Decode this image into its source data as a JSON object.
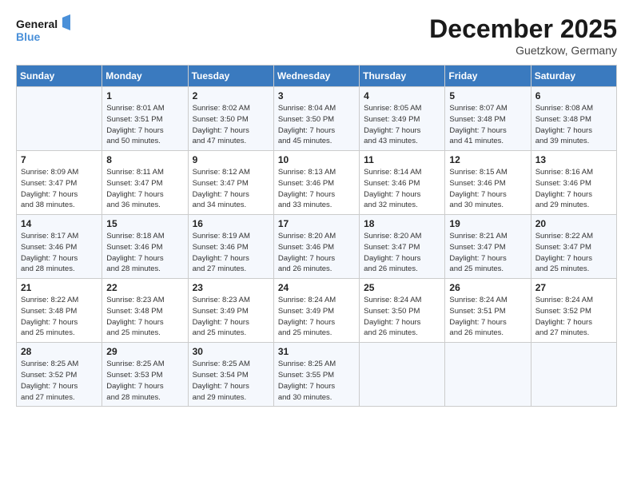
{
  "logo": {
    "line1": "General",
    "line2": "Blue"
  },
  "title": "December 2025",
  "location": "Guetzkow, Germany",
  "days_of_week": [
    "Sunday",
    "Monday",
    "Tuesday",
    "Wednesday",
    "Thursday",
    "Friday",
    "Saturday"
  ],
  "weeks": [
    [
      {
        "day": "",
        "sunrise": "",
        "sunset": "",
        "daylight": ""
      },
      {
        "day": "1",
        "sunrise": "Sunrise: 8:01 AM",
        "sunset": "Sunset: 3:51 PM",
        "daylight": "Daylight: 7 hours and 50 minutes."
      },
      {
        "day": "2",
        "sunrise": "Sunrise: 8:02 AM",
        "sunset": "Sunset: 3:50 PM",
        "daylight": "Daylight: 7 hours and 47 minutes."
      },
      {
        "day": "3",
        "sunrise": "Sunrise: 8:04 AM",
        "sunset": "Sunset: 3:50 PM",
        "daylight": "Daylight: 7 hours and 45 minutes."
      },
      {
        "day": "4",
        "sunrise": "Sunrise: 8:05 AM",
        "sunset": "Sunset: 3:49 PM",
        "daylight": "Daylight: 7 hours and 43 minutes."
      },
      {
        "day": "5",
        "sunrise": "Sunrise: 8:07 AM",
        "sunset": "Sunset: 3:48 PM",
        "daylight": "Daylight: 7 hours and 41 minutes."
      },
      {
        "day": "6",
        "sunrise": "Sunrise: 8:08 AM",
        "sunset": "Sunset: 3:48 PM",
        "daylight": "Daylight: 7 hours and 39 minutes."
      }
    ],
    [
      {
        "day": "7",
        "sunrise": "Sunrise: 8:09 AM",
        "sunset": "Sunset: 3:47 PM",
        "daylight": "Daylight: 7 hours and 38 minutes."
      },
      {
        "day": "8",
        "sunrise": "Sunrise: 8:11 AM",
        "sunset": "Sunset: 3:47 PM",
        "daylight": "Daylight: 7 hours and 36 minutes."
      },
      {
        "day": "9",
        "sunrise": "Sunrise: 8:12 AM",
        "sunset": "Sunset: 3:47 PM",
        "daylight": "Daylight: 7 hours and 34 minutes."
      },
      {
        "day": "10",
        "sunrise": "Sunrise: 8:13 AM",
        "sunset": "Sunset: 3:46 PM",
        "daylight": "Daylight: 7 hours and 33 minutes."
      },
      {
        "day": "11",
        "sunrise": "Sunrise: 8:14 AM",
        "sunset": "Sunset: 3:46 PM",
        "daylight": "Daylight: 7 hours and 32 minutes."
      },
      {
        "day": "12",
        "sunrise": "Sunrise: 8:15 AM",
        "sunset": "Sunset: 3:46 PM",
        "daylight": "Daylight: 7 hours and 30 minutes."
      },
      {
        "day": "13",
        "sunrise": "Sunrise: 8:16 AM",
        "sunset": "Sunset: 3:46 PM",
        "daylight": "Daylight: 7 hours and 29 minutes."
      }
    ],
    [
      {
        "day": "14",
        "sunrise": "Sunrise: 8:17 AM",
        "sunset": "Sunset: 3:46 PM",
        "daylight": "Daylight: 7 hours and 28 minutes."
      },
      {
        "day": "15",
        "sunrise": "Sunrise: 8:18 AM",
        "sunset": "Sunset: 3:46 PM",
        "daylight": "Daylight: 7 hours and 28 minutes."
      },
      {
        "day": "16",
        "sunrise": "Sunrise: 8:19 AM",
        "sunset": "Sunset: 3:46 PM",
        "daylight": "Daylight: 7 hours and 27 minutes."
      },
      {
        "day": "17",
        "sunrise": "Sunrise: 8:20 AM",
        "sunset": "Sunset: 3:46 PM",
        "daylight": "Daylight: 7 hours and 26 minutes."
      },
      {
        "day": "18",
        "sunrise": "Sunrise: 8:20 AM",
        "sunset": "Sunset: 3:47 PM",
        "daylight": "Daylight: 7 hours and 26 minutes."
      },
      {
        "day": "19",
        "sunrise": "Sunrise: 8:21 AM",
        "sunset": "Sunset: 3:47 PM",
        "daylight": "Daylight: 7 hours and 25 minutes."
      },
      {
        "day": "20",
        "sunrise": "Sunrise: 8:22 AM",
        "sunset": "Sunset: 3:47 PM",
        "daylight": "Daylight: 7 hours and 25 minutes."
      }
    ],
    [
      {
        "day": "21",
        "sunrise": "Sunrise: 8:22 AM",
        "sunset": "Sunset: 3:48 PM",
        "daylight": "Daylight: 7 hours and 25 minutes."
      },
      {
        "day": "22",
        "sunrise": "Sunrise: 8:23 AM",
        "sunset": "Sunset: 3:48 PM",
        "daylight": "Daylight: 7 hours and 25 minutes."
      },
      {
        "day": "23",
        "sunrise": "Sunrise: 8:23 AM",
        "sunset": "Sunset: 3:49 PM",
        "daylight": "Daylight: 7 hours and 25 minutes."
      },
      {
        "day": "24",
        "sunrise": "Sunrise: 8:24 AM",
        "sunset": "Sunset: 3:49 PM",
        "daylight": "Daylight: 7 hours and 25 minutes."
      },
      {
        "day": "25",
        "sunrise": "Sunrise: 8:24 AM",
        "sunset": "Sunset: 3:50 PM",
        "daylight": "Daylight: 7 hours and 26 minutes."
      },
      {
        "day": "26",
        "sunrise": "Sunrise: 8:24 AM",
        "sunset": "Sunset: 3:51 PM",
        "daylight": "Daylight: 7 hours and 26 minutes."
      },
      {
        "day": "27",
        "sunrise": "Sunrise: 8:24 AM",
        "sunset": "Sunset: 3:52 PM",
        "daylight": "Daylight: 7 hours and 27 minutes."
      }
    ],
    [
      {
        "day": "28",
        "sunrise": "Sunrise: 8:25 AM",
        "sunset": "Sunset: 3:52 PM",
        "daylight": "Daylight: 7 hours and 27 minutes."
      },
      {
        "day": "29",
        "sunrise": "Sunrise: 8:25 AM",
        "sunset": "Sunset: 3:53 PM",
        "daylight": "Daylight: 7 hours and 28 minutes."
      },
      {
        "day": "30",
        "sunrise": "Sunrise: 8:25 AM",
        "sunset": "Sunset: 3:54 PM",
        "daylight": "Daylight: 7 hours and 29 minutes."
      },
      {
        "day": "31",
        "sunrise": "Sunrise: 8:25 AM",
        "sunset": "Sunset: 3:55 PM",
        "daylight": "Daylight: 7 hours and 30 minutes."
      },
      {
        "day": "",
        "sunrise": "",
        "sunset": "",
        "daylight": ""
      },
      {
        "day": "",
        "sunrise": "",
        "sunset": "",
        "daylight": ""
      },
      {
        "day": "",
        "sunrise": "",
        "sunset": "",
        "daylight": ""
      }
    ]
  ]
}
